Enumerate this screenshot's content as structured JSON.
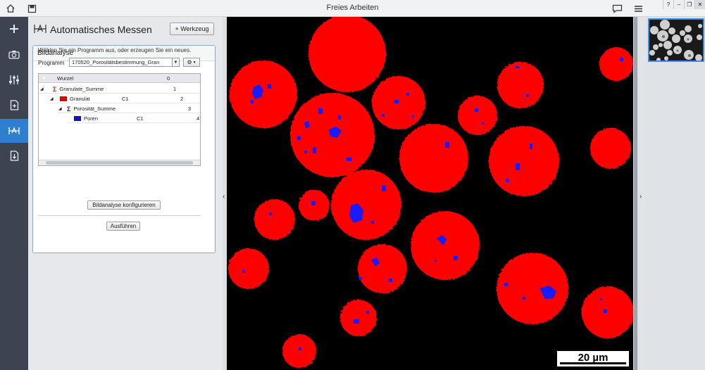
{
  "window": {
    "title": "Freies Arbeiten"
  },
  "panel": {
    "title": "Automatisches Messen",
    "add_tool_label": "+ Werkzeug",
    "section_title": "Bildanalyse",
    "hint": "Wählen Sie ein Programm aus, oder erzeugen Sie ein neues.",
    "program_label": "Programm",
    "program_value": "170520_Porositätsbestimmung_Gran",
    "tree": {
      "header": {
        "name": "Wurzel",
        "value": "0"
      },
      "rows": [
        {
          "name": "Granulate_Summe",
          "class": "",
          "value": "1"
        },
        {
          "name": "Granulat",
          "class": "C1",
          "value": "2"
        },
        {
          "name": "Porosität_Summe",
          "class": "",
          "value": "3"
        },
        {
          "name": "Poren",
          "class": "C1",
          "value": "4"
        }
      ]
    },
    "configure_label": "Bildanalyse konfigurieren",
    "run_label": "Ausführen"
  },
  "image": {
    "scale_label": "20 µm"
  },
  "colors": {
    "granule": "#ff0000",
    "pore": "#1a1aff",
    "accent": "#2f7fcf"
  }
}
